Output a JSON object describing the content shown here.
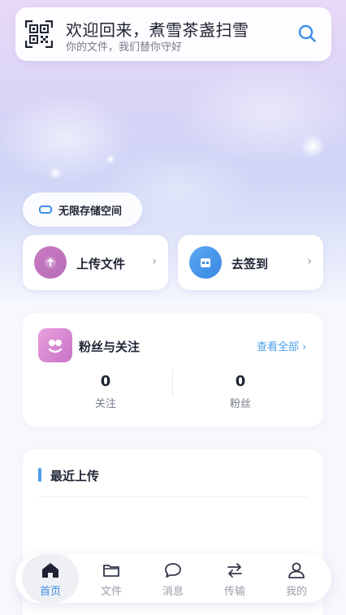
{
  "header": {
    "welcome": "欢迎回来，煮雪茶盏扫雪",
    "subtitle": "你的文件，我们替你守好",
    "qr_icon": "qr-code-icon",
    "search_icon": "search-icon"
  },
  "storage_chip": {
    "label": "无限存储空间",
    "icon": "storage-icon"
  },
  "actions": [
    {
      "label": "上传文件",
      "icon": "upload-icon",
      "chevron": "›"
    },
    {
      "label": "去签到",
      "icon": "calendar-icon",
      "chevron": "›"
    }
  ],
  "fans": {
    "title": "粉丝与关注",
    "view_all": "查看全部",
    "view_all_chevron": "›",
    "stats": [
      {
        "value": "0",
        "label": "关注"
      },
      {
        "value": "0",
        "label": "粉丝"
      }
    ]
  },
  "recent": {
    "title": "最近上传"
  },
  "nav": {
    "items": [
      {
        "label": "首页",
        "icon": "home-icon",
        "active": true
      },
      {
        "label": "文件",
        "icon": "folder-icon",
        "active": false
      },
      {
        "label": "消息",
        "icon": "message-icon",
        "active": false
      },
      {
        "label": "传输",
        "icon": "transfer-icon",
        "active": false
      },
      {
        "label": "我的",
        "icon": "user-icon",
        "active": false
      }
    ]
  },
  "colors": {
    "accent": "#3b8fe8",
    "upload": "#c97bc2",
    "signin": "#4a98ec"
  }
}
